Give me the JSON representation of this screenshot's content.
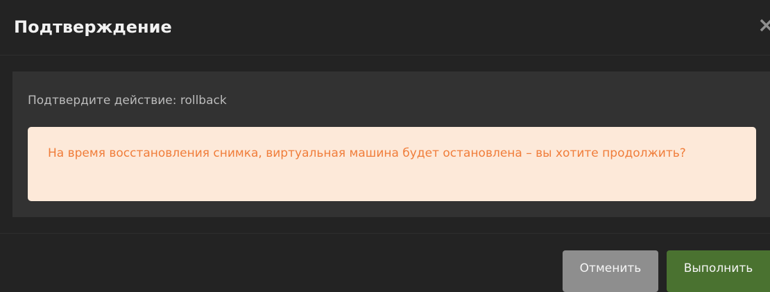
{
  "dialog": {
    "title": "Подтверждение",
    "close_symbol": "×"
  },
  "body": {
    "confirm_text": "Подтвердите действие: rollback",
    "warning_text": "На время восстановления снимка, виртуальная машина будет остановлена – вы хотите продолжить?"
  },
  "footer": {
    "cancel_label": "Отменить",
    "execute_label": "Выполнить"
  },
  "colors": {
    "background": "#232323",
    "body_panel": "#323232",
    "warning_background": "#fde9d9",
    "warning_text": "#f07d3a",
    "cancel_button": "#8e8e8e",
    "execute_button": "#4a7230"
  },
  "icons": {
    "close": "close-icon"
  }
}
